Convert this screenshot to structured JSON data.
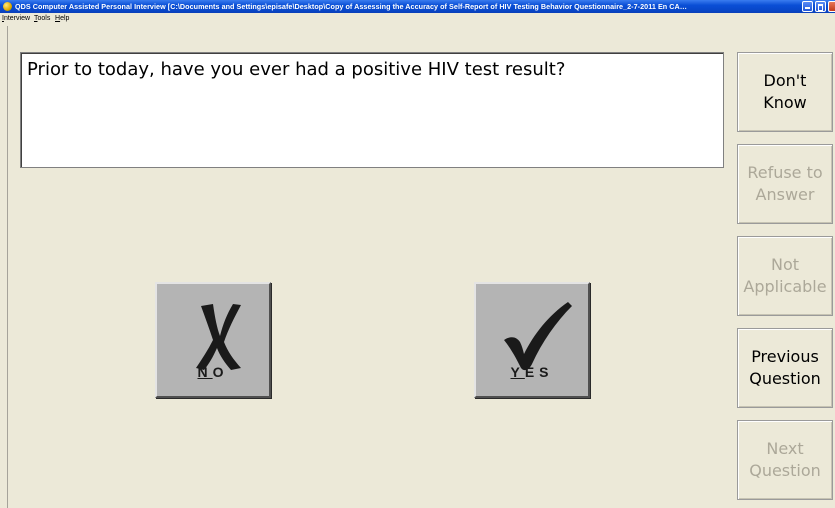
{
  "window": {
    "title": "QDS Computer Assisted Personal Interview [C:\\Documents and Settings\\episafe\\Desktop\\Copy of Assessing the Accuracy of Self-Report of HIV Testing Behavior Questionnaire_2-7-2011 En CA…"
  },
  "menu": [
    {
      "label": "Interview"
    },
    {
      "label": "Tools"
    },
    {
      "label": "Help"
    }
  ],
  "question": {
    "text": "Prior to today, have you ever had a positive HIV test result?"
  },
  "answers": {
    "no_label": "NO",
    "yes_label": "YES"
  },
  "side_buttons": {
    "dont_know": "Don't\nKnow",
    "refuse": "Refuse to\nAnswer",
    "not_applicable": "Not\nApplicable",
    "previous": "Previous\nQuestion",
    "next": "Next\nQuestion"
  },
  "colors": {
    "background": "#ece9d8",
    "titlebar": "#0a4fd6",
    "disabled_text": "#aca899"
  }
}
